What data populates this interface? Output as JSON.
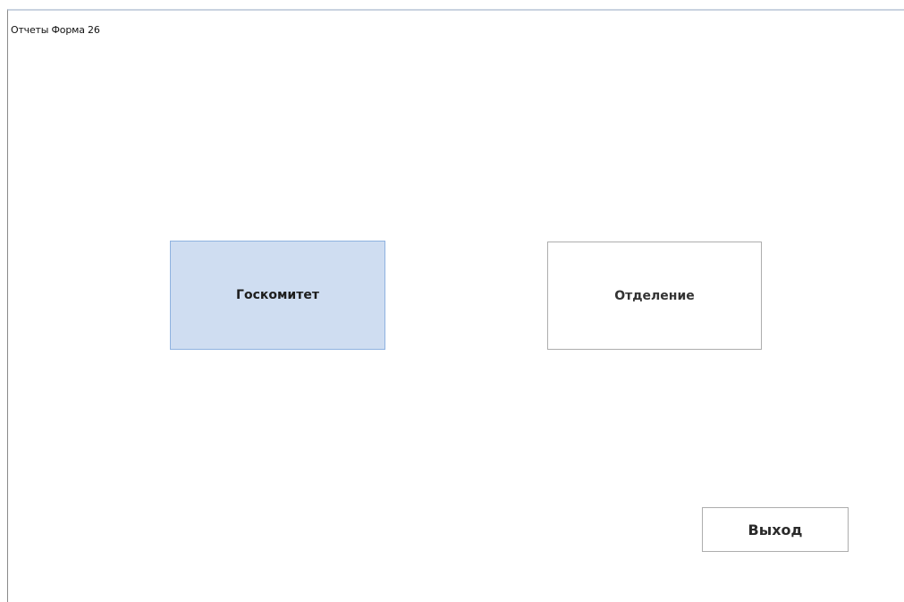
{
  "window": {
    "title": "Отчеты Форма 26"
  },
  "buttons": {
    "goskomitet_label": "Госкомитет",
    "otdelenie_label": "Отделение",
    "exit_label": "Выход"
  },
  "colors": {
    "focused_button_bg": "#cfddf1",
    "focused_button_border": "#8fb2e0",
    "button_border": "#adadad"
  }
}
